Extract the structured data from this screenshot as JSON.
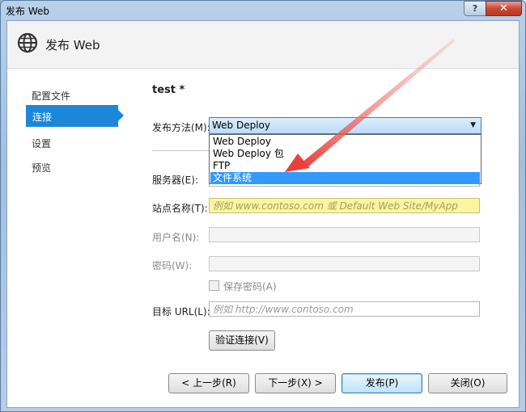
{
  "window": {
    "title": "发布 Web",
    "help_label": "?",
    "close_label": "✕"
  },
  "header": {
    "title": "发布 Web",
    "icon": "globe-icon"
  },
  "nav": {
    "items": [
      "配置文件",
      "连接",
      "设置",
      "预览"
    ],
    "active_index": 1
  },
  "profile": {
    "name": "test *"
  },
  "form": {
    "method_label": "发布方法(M):",
    "method_value": "Web Deploy",
    "method_options": [
      "Web Deploy",
      "Web Deploy 包",
      "FTP",
      "文件系统"
    ],
    "method_highlighted": "文件系统",
    "server_label": "服务器(E):",
    "site_label": "站点名称(T):",
    "site_placeholder": "例如 www.contoso.com 或 Default Web Site/MyApp",
    "user_label": "用户名(N):",
    "password_label": "密码(W):",
    "save_password_label": "保存密码(A)",
    "dest_label": "目标 URL(L):",
    "dest_placeholder": "例如 http://www.contoso.com",
    "validate_button": "验证连接(V)"
  },
  "footer": {
    "prev": "< 上一步(R)",
    "next": "下一步(X) >",
    "publish": "发布(P)",
    "close": "关闭(O)"
  },
  "colors": {
    "accent": "#1c87d8",
    "selection": "#3399ff",
    "annotation_arrow": "#e8413c"
  }
}
